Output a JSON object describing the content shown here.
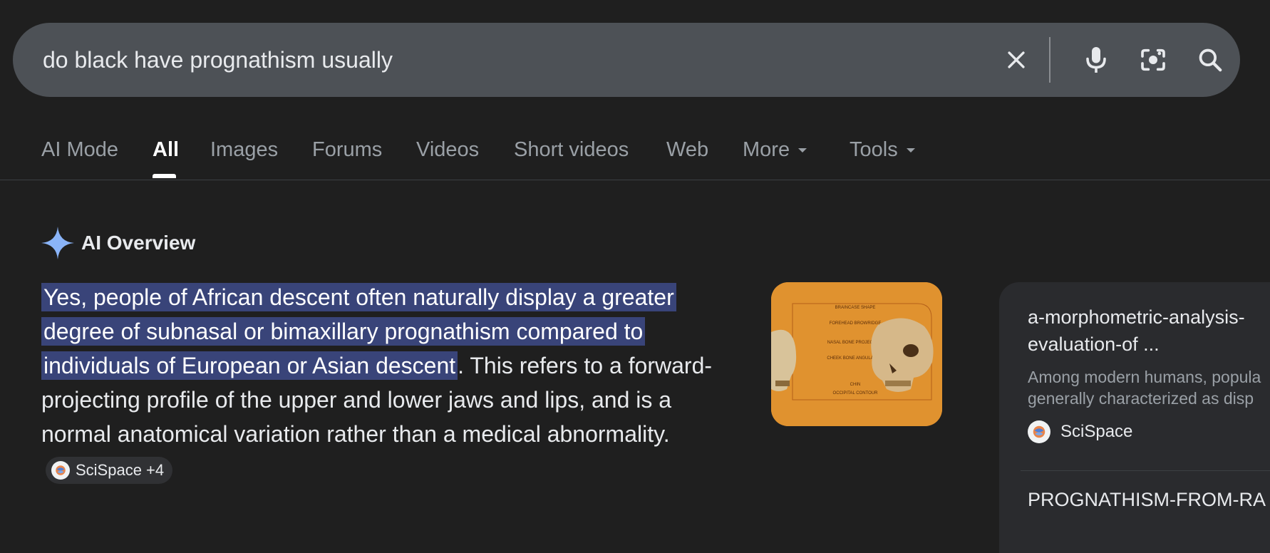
{
  "search": {
    "query": "do black have prognathism usually"
  },
  "tabs": [
    {
      "label": "AI Mode"
    },
    {
      "label": "All"
    },
    {
      "label": "Images"
    },
    {
      "label": "Forums"
    },
    {
      "label": "Videos"
    },
    {
      "label": "Short videos"
    },
    {
      "label": "Web"
    },
    {
      "label": "More"
    },
    {
      "label": "Tools"
    }
  ],
  "active_tab": "All",
  "ai_overview": {
    "title": "AI Overview",
    "highlighted_text": "Yes, people of African descent often naturally display a greater degree of subnasal or bimaxillary prognathism compared to individuals of European or Asian descent",
    "rest_text": ". This refers to a forward-projecting profile of the upper and lower jaws and lips, and is a normal anatomical variation rather than a medical abnormality.",
    "citation": "SciSpace +4",
    "thumbnail_labels": [
      "BRAINCASE SHAPE",
      "FOREHEAD BROWRIDGE",
      "NASAL BONE PROJECTION",
      "CHEEK BONE ANGULATION",
      "CHIN",
      "OCCIPITAL CONTOUR"
    ]
  },
  "source_card": {
    "title_line1": "a-morphometric-analysis-",
    "title_line2": "evaluation-of ...",
    "snippet_line1": "Among modern humans, popula",
    "snippet_line2": "generally characterized as disp",
    "source": "SciSpace",
    "next_title": "PROGNATHISM-FROM-RA"
  },
  "colors": {
    "background": "#1f1f1f",
    "search_bar": "#4d5156",
    "highlight": "#394479",
    "spark_icon": "#8ab4f8"
  }
}
